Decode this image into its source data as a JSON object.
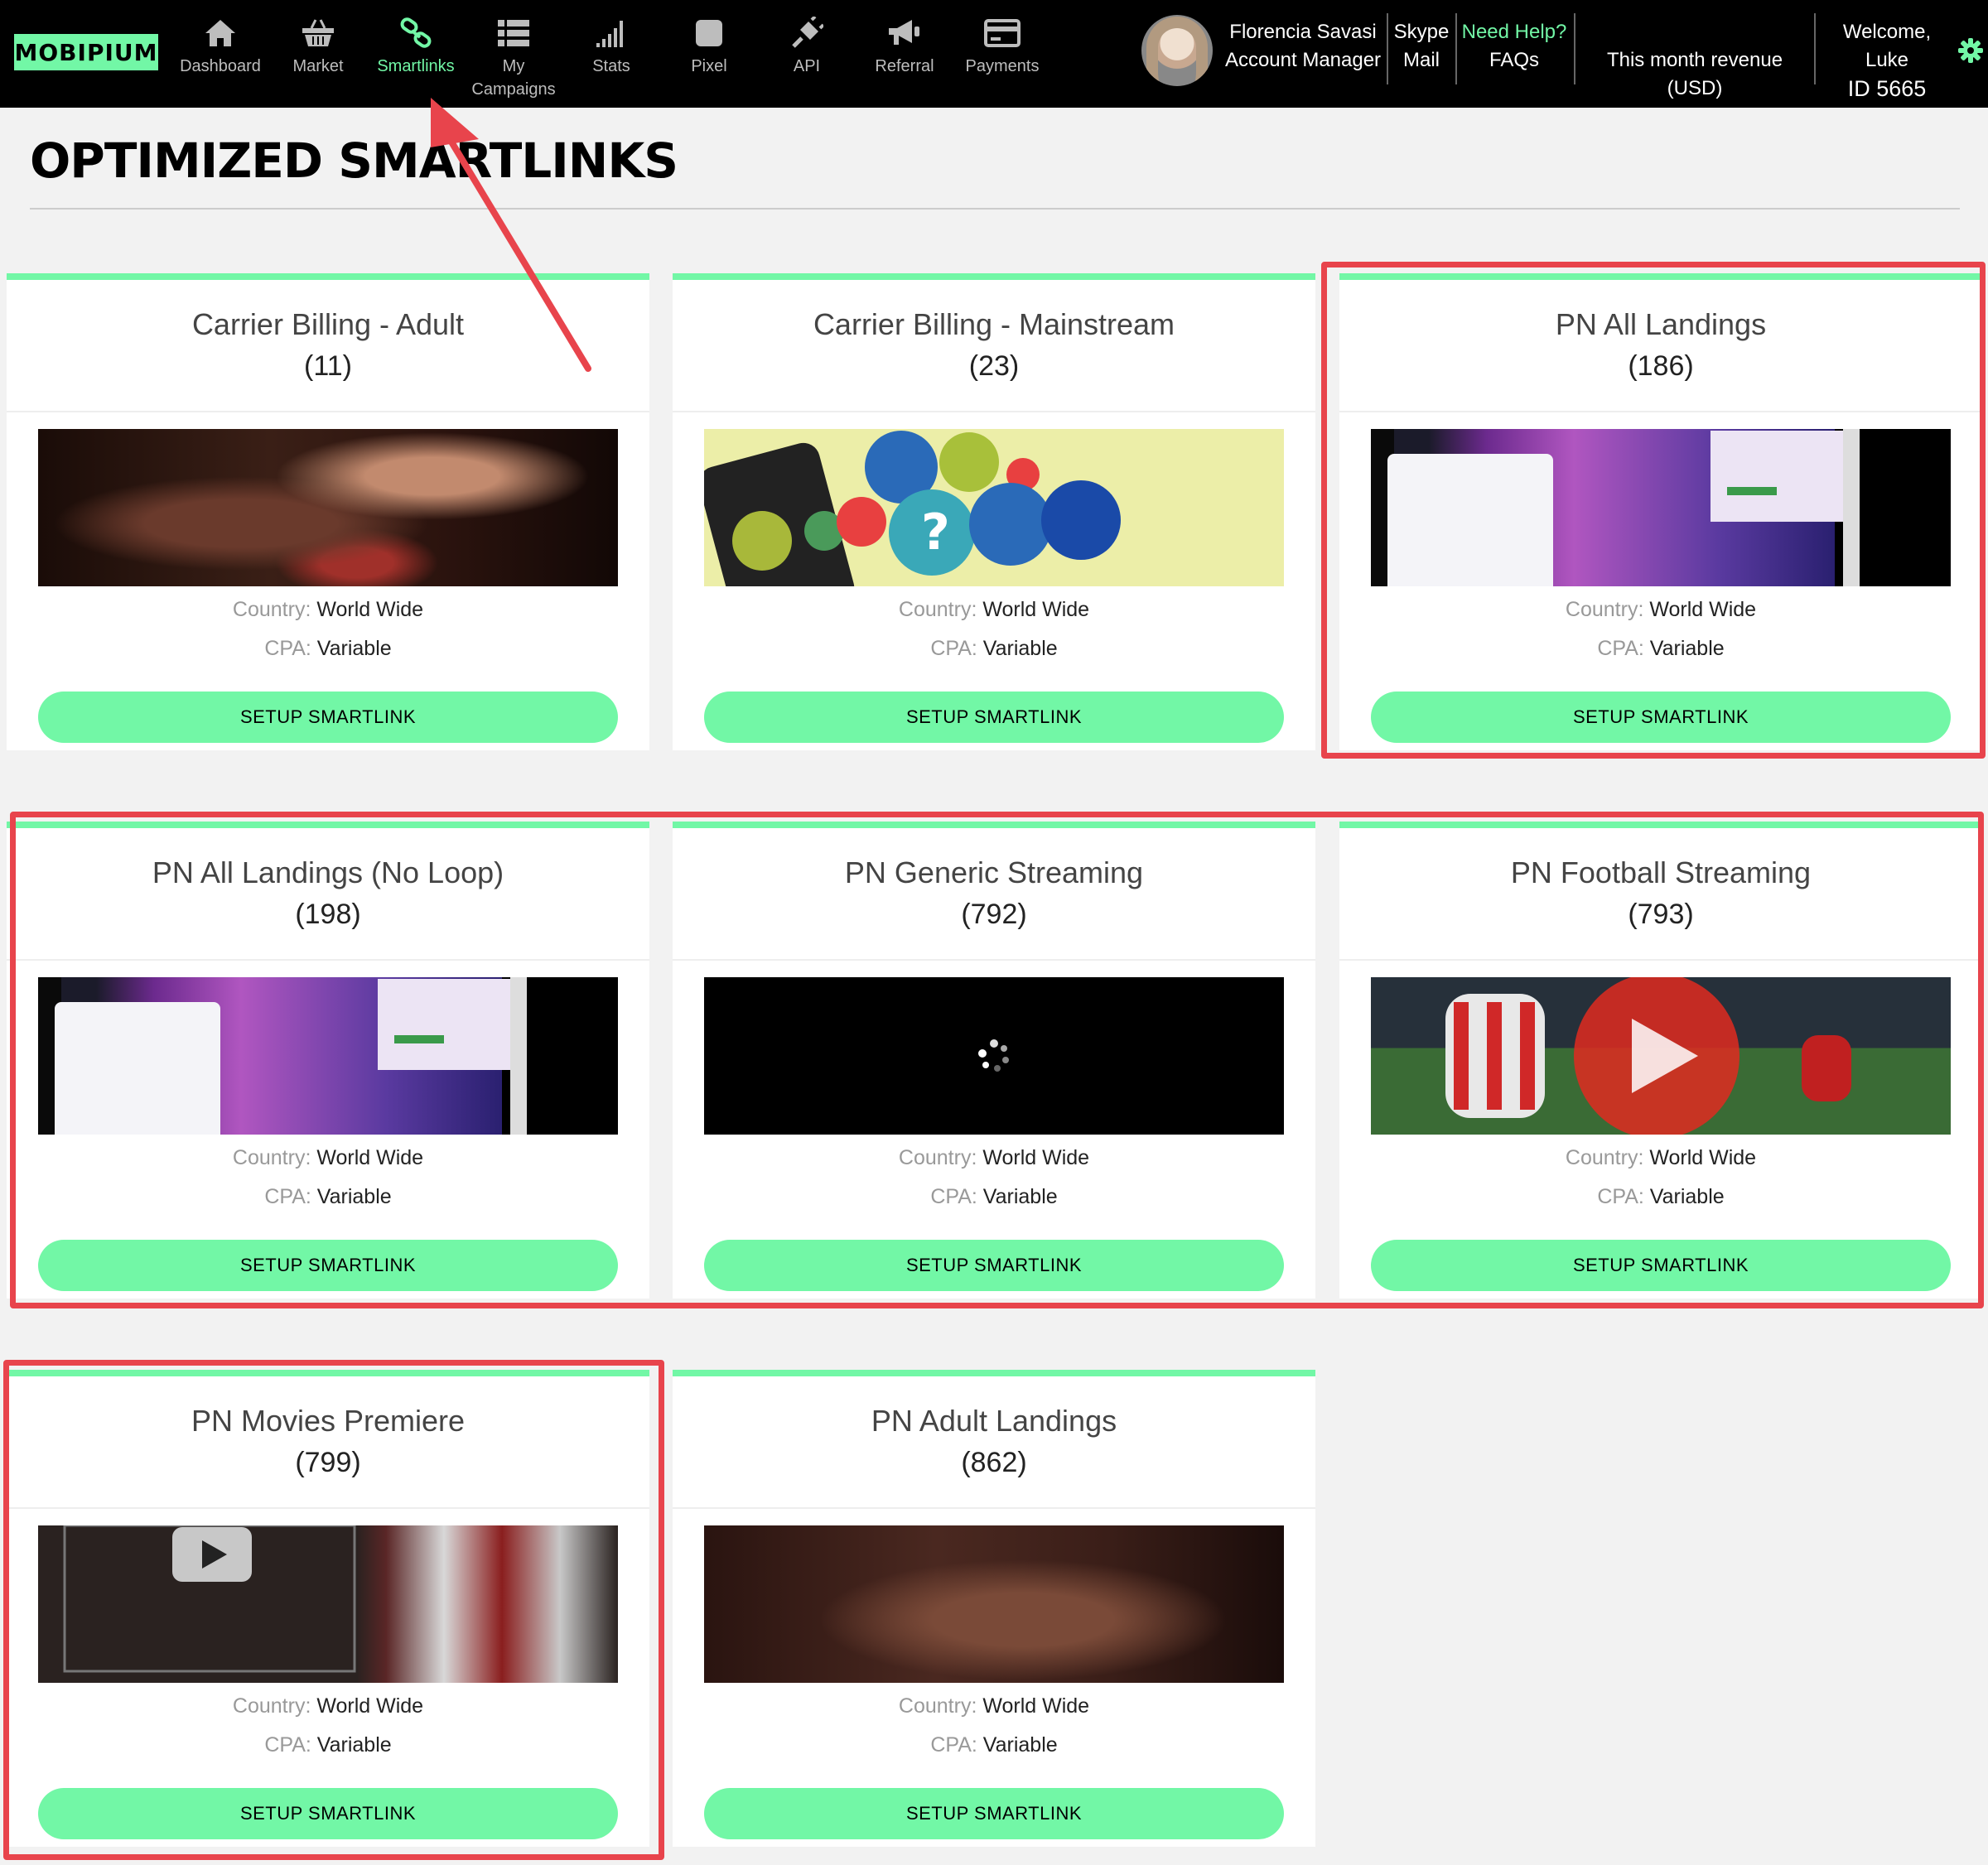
{
  "app": {
    "logo": "MOBIPIUM",
    "nav": [
      {
        "label": "Dashboard",
        "icon": "home-icon"
      },
      {
        "label": "Market",
        "icon": "basket-icon"
      },
      {
        "label": "Smartlinks",
        "icon": "link-icon",
        "active": true
      },
      {
        "label": "My Campaigns",
        "icon": "list-icon"
      },
      {
        "label": "Stats",
        "icon": "signal-bars-icon"
      },
      {
        "label": "Pixel",
        "icon": "pixel-square-icon"
      },
      {
        "label": "API",
        "icon": "plug-icon"
      },
      {
        "label": "Referral",
        "icon": "megaphone-icon"
      },
      {
        "label": "Payments",
        "icon": "credit-card-icon"
      }
    ],
    "manager": {
      "name": "Florencia Savasi",
      "role": "Account Manager"
    },
    "contact": {
      "line1": "Skype",
      "line2": "Mail"
    },
    "help": {
      "line1": "Need Help?",
      "line2": "FAQs"
    },
    "revenue": {
      "label": "This month revenue (USD)"
    },
    "welcome": {
      "line1": "Welcome, Luke",
      "line2": "ID 5665"
    }
  },
  "colors": {
    "accent": "#72f7a6",
    "annotation": "#e8444c",
    "topbar": "#000000"
  },
  "page": {
    "title": "OPTIMIZED SMARTLINKS"
  },
  "cards": [
    {
      "name": "Carrier Billing - Adult",
      "count": "(11)",
      "country_label": "Country:",
      "country": "World Wide",
      "cpa_label": "CPA:",
      "cpa": "Variable",
      "button": "SETUP SMARTLINK"
    },
    {
      "name": "Carrier Billing - Mainstream",
      "count": "(23)",
      "country_label": "Country:",
      "country": "World Wide",
      "cpa_label": "CPA:",
      "cpa": "Variable",
      "button": "SETUP SMARTLINK"
    },
    {
      "name": "PN All Landings",
      "count": "(186)",
      "country_label": "Country:",
      "country": "World Wide",
      "cpa_label": "CPA:",
      "cpa": "Variable",
      "button": "SETUP SMARTLINK"
    },
    {
      "name": "PN All Landings (No Loop)",
      "count": "(198)",
      "country_label": "Country:",
      "country": "World Wide",
      "cpa_label": "CPA:",
      "cpa": "Variable",
      "button": "SETUP SMARTLINK"
    },
    {
      "name": "PN Generic Streaming",
      "count": "(792)",
      "country_label": "Country:",
      "country": "World Wide",
      "cpa_label": "CPA:",
      "cpa": "Variable",
      "button": "SETUP SMARTLINK"
    },
    {
      "name": "PN Football Streaming",
      "count": "(793)",
      "country_label": "Country:",
      "country": "World Wide",
      "cpa_label": "CPA:",
      "cpa": "Variable",
      "button": "SETUP SMARTLINK"
    },
    {
      "name": "PN Movies Premiere",
      "count": "(799)",
      "country_label": "Country:",
      "country": "World Wide",
      "cpa_label": "CPA:",
      "cpa": "Variable",
      "button": "SETUP SMARTLINK"
    },
    {
      "name": "PN Adult Landings",
      "count": "(862)",
      "country_label": "Country:",
      "country": "World Wide",
      "cpa_label": "CPA:",
      "cpa": "Variable",
      "button": "SETUP SMARTLINK"
    }
  ]
}
